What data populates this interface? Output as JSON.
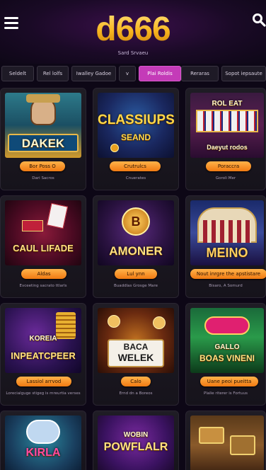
{
  "header": {
    "logo": "d666",
    "tagline": "Sard Srvaeu"
  },
  "filters": [
    {
      "label": "Seldelt"
    },
    {
      "label": "Rel lolfs"
    },
    {
      "label": "Iwalley Gadoe"
    },
    {
      "label": "v"
    },
    {
      "label": "Plai Roldis"
    },
    {
      "label": "Reraras"
    },
    {
      "label": "Sopot iepsaute"
    }
  ],
  "games": [
    {
      "title": "DAKEK",
      "button": "Bor Poss O",
      "caption": "Dari Sacros"
    },
    {
      "title": "CLASSIUPS",
      "subtitle": "SEAND",
      "button": "Crutrulcs",
      "caption": "Cnuerates"
    },
    {
      "title": "ROL EAT",
      "subtitle": "Daeyut rodos",
      "button": "Poraccra",
      "caption": "Goroli Mer"
    },
    {
      "title": "CAUL LIFADE",
      "button": "Aldas",
      "caption": "Evceeting sacrato ttlarls"
    },
    {
      "title": "AMONER",
      "subtitle": "B",
      "button": "Lul ynn",
      "caption": "Buaddlas Grosge Mare"
    },
    {
      "title": "MEINO",
      "button": "Nout inrgre the apstistare",
      "caption": "Bisaro, A Somurd"
    },
    {
      "title": "INPEATCPEER",
      "subtitle": "KOREIA",
      "button": "Lassiol arrvod",
      "caption": "Lorecialguge stigeg is mreurtia verses"
    },
    {
      "title": "WELEK",
      "subtitle": "BACA",
      "button": "Calo",
      "caption": "Ernd dn a Boreos"
    },
    {
      "title": "BOAS VINENI",
      "subtitle": "GALLO",
      "button": "Uane peoi pueitta",
      "caption": "Plalie riterer is Fortuus"
    },
    {
      "title": "KIRLA",
      "button": "",
      "caption": ""
    },
    {
      "title": "POWFLALR",
      "subtitle": "WOBIN",
      "button": "",
      "caption": ""
    },
    {
      "title": "",
      "button": "",
      "caption": ""
    }
  ],
  "colors": {
    "accent": "#c43bb8",
    "button": "#f07a12",
    "logo": "#f7b51e",
    "background": "#0d0716"
  }
}
